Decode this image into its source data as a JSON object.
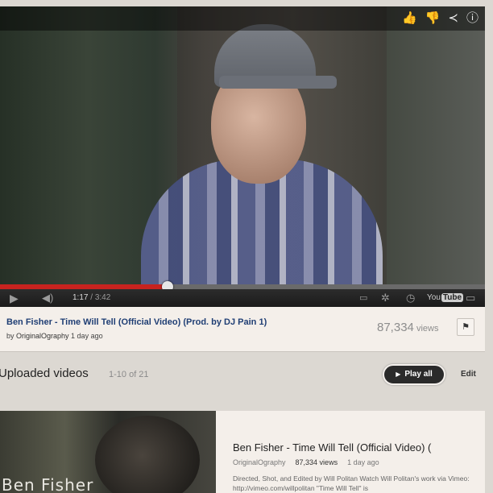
{
  "player": {
    "top_icons": [
      {
        "name": "like-icon",
        "glyph": "👍"
      },
      {
        "name": "dislike-icon",
        "glyph": "👎"
      },
      {
        "name": "share-icon",
        "glyph": "≺"
      },
      {
        "name": "info-icon",
        "glyph": "ⓘ"
      }
    ],
    "progress_fraction": 0.345,
    "current_time": "1:17",
    "separator": " / ",
    "duration": "3:42",
    "youtube_logo": {
      "you": "You",
      "tube": "Tube"
    },
    "accent_color": "#c8231f"
  },
  "video": {
    "title": "Ben Fisher - Time Will Tell (Official Video) (Prod. by DJ Pain 1)",
    "by_prefix": "by ",
    "channel": "OriginalOgraphy",
    "age": " 1 day ago",
    "views_number": "87,334",
    "views_label": " views"
  },
  "uploads": {
    "title": "Uploaded videos",
    "count": "1-10 of 21",
    "play_all_label": "Play all",
    "edit_label": "Edit"
  },
  "list": [
    {
      "thumbnail_text": "Ben Fisher",
      "title": "Ben Fisher - Time Will Tell (Official Video) (",
      "channel": "OriginalOgraphy",
      "views": "87,334 views",
      "age": "1 day ago",
      "description": "Directed, Shot, and Edited by Will Politan Watch Will Politan's work via Vimeo: http://vimeo.com/willpolitan \"Time Will Tell\" is"
    }
  ]
}
